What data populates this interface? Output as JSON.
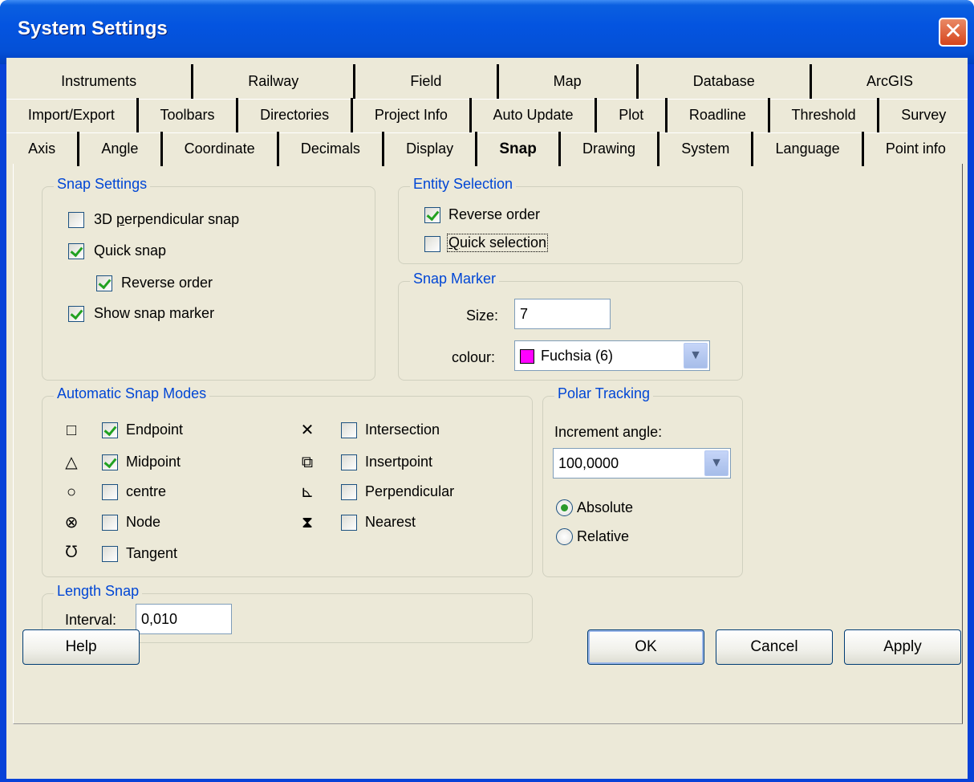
{
  "window": {
    "title": "System Settings",
    "close_symbol": "✕"
  },
  "tabs": {
    "row1": [
      "Instruments",
      "Railway",
      "Field",
      "Map",
      "Database",
      "ArcGIS"
    ],
    "row2": [
      "Import/Export",
      "Toolbars",
      "Directories",
      "Project Info",
      "Auto Update",
      "Plot",
      "Roadline",
      "Threshold",
      "Survey"
    ],
    "row3": [
      "Axis",
      "Angle",
      "Coordinate",
      "Decimals",
      "Display",
      "Snap",
      "Drawing",
      "System",
      "Language",
      "Point info"
    ],
    "selected": "Snap"
  },
  "snap_settings": {
    "title": "Snap Settings",
    "perp_pre": "3D ",
    "perp_u": "p",
    "perp_post": "erpendicular snap",
    "quick_snap": "Quick snap",
    "reverse_order": "Reverse order",
    "show_marker": "Show snap marker",
    "perp_checked": false,
    "quick_snap_checked": true,
    "reverse_order_checked": true,
    "show_marker_checked": true
  },
  "entity_selection": {
    "title": "Entity Selection",
    "reverse_order": "Reverse order",
    "quick_selection_u": "Q",
    "quick_selection_rest": "uick selection",
    "reverse_checked": true,
    "quick_checked": false
  },
  "snap_marker": {
    "title": "Snap Marker",
    "size_label": "Size:",
    "size_value": "7",
    "colour_label": "colour:",
    "colour_value": "Fuchsia (6)",
    "colour_swatch": "#ff00ff"
  },
  "auto_snap": {
    "title": "Automatic Snap Modes",
    "left": [
      {
        "icon": "□",
        "label": "Endpoint",
        "checked": true
      },
      {
        "icon": "△",
        "label": "Midpoint",
        "checked": true
      },
      {
        "icon": "○",
        "label": "centre",
        "checked": false
      },
      {
        "icon": "⊗",
        "label": "Node",
        "checked": false
      },
      {
        "icon": "ᘮ",
        "label": "Tangent",
        "checked": false
      }
    ],
    "right": [
      {
        "icon": "✕",
        "label": "Intersection",
        "checked": false
      },
      {
        "icon": "⧉",
        "label": "Insertpoint",
        "checked": false
      },
      {
        "icon": "⊾",
        "label": "Perpendicular",
        "checked": false
      },
      {
        "icon": "⧗",
        "label": "Nearest",
        "checked": false
      }
    ]
  },
  "polar": {
    "title": "Polar Tracking",
    "increment_label": "Increment angle:",
    "increment_value": "100,0000",
    "absolute": "Absolute",
    "relative": "Relative",
    "selected": "Absolute"
  },
  "length_snap": {
    "title": "Length Snap",
    "interval_label": "Interval:",
    "interval_value": "0,010"
  },
  "buttons": {
    "help": "Help",
    "ok": "OK",
    "cancel": "Cancel",
    "apply": "Apply"
  }
}
